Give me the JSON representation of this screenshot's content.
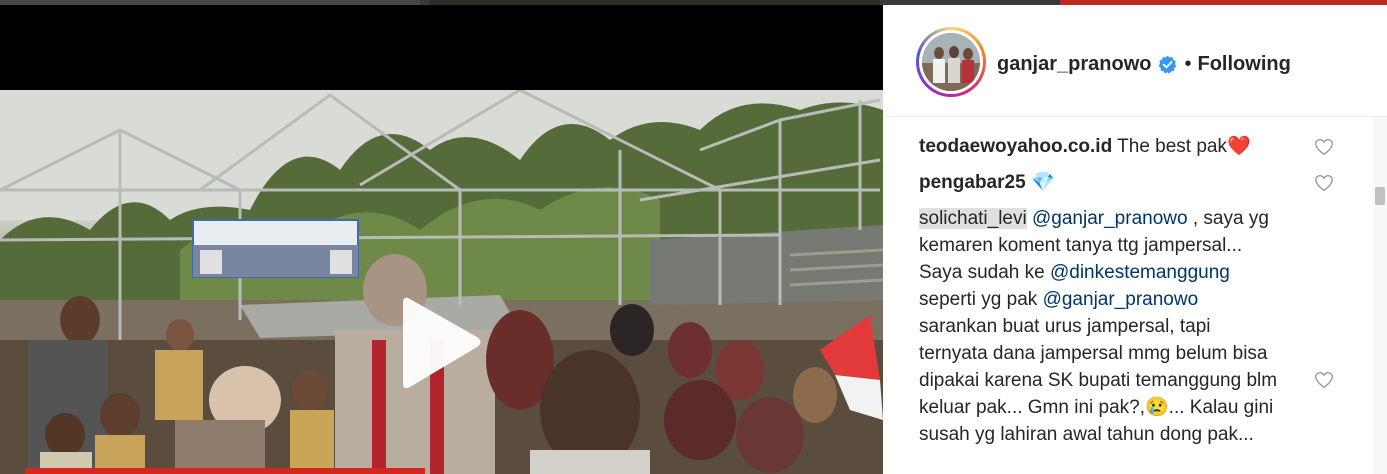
{
  "post": {
    "author": "ganjar_pranowo",
    "verified": true,
    "separator": "•",
    "follow_status": "Following"
  },
  "media": {
    "type": "video",
    "play_icon": "play-icon",
    "banner_color": "#d7261d"
  },
  "comments": [
    {
      "user": "teodaewoyahoo.co.id",
      "text": "The best pak",
      "emoji": "❤️"
    },
    {
      "user": "pengabar25",
      "text": "",
      "emoji": "💎"
    },
    {
      "user": "solichati_levi",
      "parts": [
        {
          "mention": "@ganjar_pranowo"
        },
        {
          "text": " , saya yg kemaren koment tanya ttg jampersal... Saya sudah ke "
        },
        {
          "mention": "@dinkestemanggung"
        },
        {
          "text": " seperti yg pak "
        },
        {
          "mention": "@ganjar_pranowo"
        },
        {
          "text": " sarankan buat urus jampersal, tapi ternyata dana jampersal mmg belum bisa dipakai karena SK bupati temanggung blm keluar pak... Gmn ini pak?,"
        },
        {
          "emoji": "😢"
        },
        {
          "text": "... Kalau gini susah yg lahiran awal tahun dong pak..."
        }
      ]
    }
  ],
  "colors": {
    "text": "#262626",
    "mention": "#003569",
    "verified": "#3897f0",
    "border": "#efefef"
  }
}
